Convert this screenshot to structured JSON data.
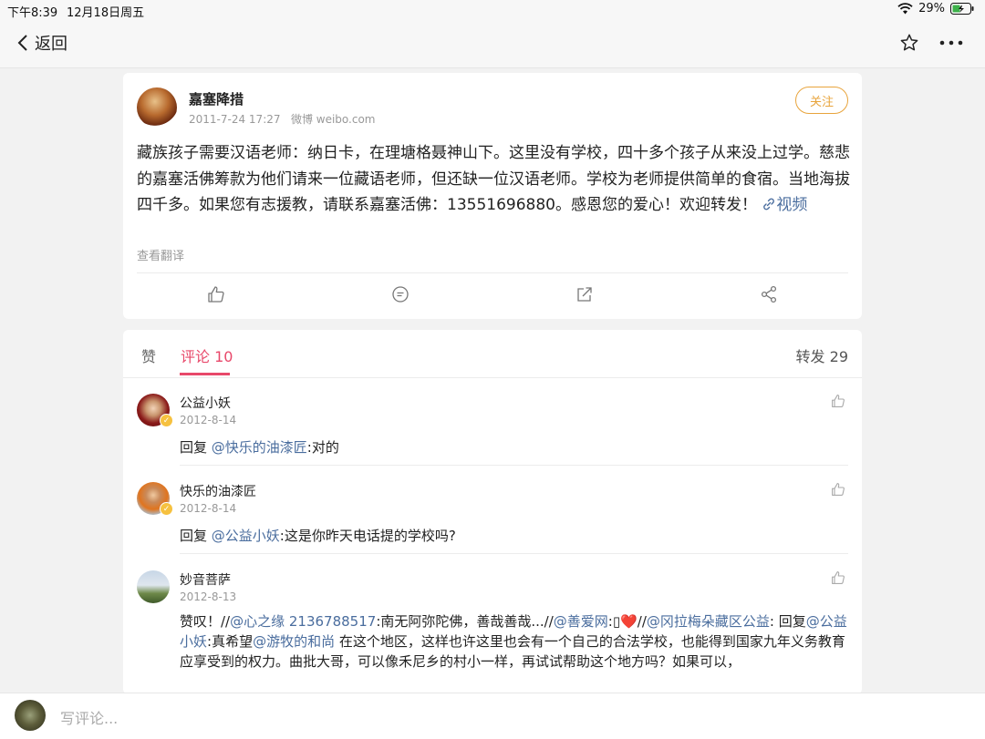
{
  "statusbar": {
    "time": "下午8:39",
    "date": "12月18日周五",
    "battery": "29%"
  },
  "navbar": {
    "back_label": "返回"
  },
  "post": {
    "author": "嘉塞降措",
    "timestamp": "2011-7-24 17:27",
    "source": "微博 weibo.com",
    "follow_label": "关注",
    "content": "藏族孩子需要汉语老师：纳日卡，在理塘格聂神山下。这里没有学校，四十多个孩子从来没上过学。慈悲的嘉塞活佛筹款为他们请来一位藏语老师，但还缺一位汉语老师。学校为老师提供简单的食宿。当地海拔四千多。如果您有志援教，请联系嘉塞活佛：13551696880。感恩您的爱心！欢迎转发！",
    "video_link": "视频",
    "translate": "查看翻译"
  },
  "tabs": {
    "likes": "赞",
    "comments": "评论 10",
    "reposts": "转发 29"
  },
  "comments": [
    {
      "name": "公益小妖",
      "date": "2012-8-14",
      "prefix": "回复 ",
      "mention": "@快乐的油漆匠",
      "text": ":对的"
    },
    {
      "name": "快乐的油漆匠",
      "date": "2012-8-14",
      "prefix": "回复 ",
      "mention": "@公益小妖",
      "text": ":这是你昨天电话提的学校吗?"
    },
    {
      "name": "妙音菩萨",
      "date": "2012-8-13",
      "t1": "赞叹！//",
      "m1": "@心之缘 2136788517",
      "t2": ":南无阿弥陀佛，善哉善哉...//",
      "m2": "@善爱网",
      "t3": ":▯❤️//",
      "m3": "@冈拉梅朵藏区公益",
      "t4": ": 回复",
      "m4": "@公益小妖",
      "t5": ":真希望",
      "m5": "@游牧的和尚",
      "t6": " 在这个地区，这样也许这里也会有一个自己的合法学校，也能得到国家九年义务教育应享受到的权力。曲批大哥，可以像禾尼乡的村小一样，再试试帮助这个地方吗？如果可以，"
    }
  ],
  "bottombar": {
    "placeholder": "写评论..."
  }
}
